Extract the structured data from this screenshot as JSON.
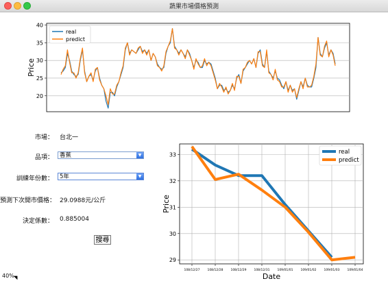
{
  "window": {
    "title": "蔬果市場價格預測"
  },
  "form": {
    "market_label": "市場：",
    "market_value": "台北一",
    "product_label": "品項：",
    "product_value": "香蕉",
    "years_label": "訓練年份數：",
    "years_value": "5年",
    "predicted_label": "預測下次開市價格：",
    "predicted_value": "29.0988元/公斤",
    "r2_label": "決定係數：",
    "r2_value": "0.885004",
    "search_label": "搜尋"
  },
  "status": {
    "progress_text": "40%"
  },
  "colors": {
    "real": "#1f77b4",
    "predict": "#ff7f0e"
  },
  "chart_data": [
    {
      "type": "line",
      "ylabel": "Price",
      "xlabel": "",
      "ylim": [
        15.5,
        40.5
      ],
      "yticks": [
        20,
        25,
        30,
        35,
        40
      ],
      "grid": "horizontal",
      "legend": "top-left",
      "series": [
        {
          "name": "real",
          "values": [
            26.5,
            27,
            28,
            32,
            30,
            27,
            26,
            25.5,
            26,
            30,
            33,
            27,
            24,
            25.5,
            26,
            24.5,
            27,
            28,
            25,
            23,
            22,
            18.5,
            16.5,
            21,
            21,
            20,
            22.5,
            24,
            26,
            28,
            33,
            35,
            32,
            33,
            32.5,
            32,
            33,
            34,
            32.5,
            33,
            32,
            33,
            30,
            32,
            31,
            29,
            28,
            27.5,
            28,
            32,
            34,
            35,
            39,
            34,
            33,
            32,
            33,
            32,
            31,
            33,
            32,
            30,
            28,
            30,
            29.5,
            28,
            28,
            30,
            29,
            29.5,
            29,
            27,
            25,
            22,
            23,
            23,
            21.5,
            22,
            21,
            21.5,
            23,
            22,
            25,
            26,
            23.5,
            27,
            28,
            29,
            30,
            29,
            30.5,
            28,
            32,
            33,
            29,
            28,
            32.5,
            27,
            26,
            25,
            27,
            25,
            24.5,
            23,
            22,
            24,
            21.5,
            23,
            21.5,
            22,
            19,
            21.5,
            24,
            22.5,
            25,
            23,
            22.5,
            22.5,
            25,
            28,
            36.5,
            32,
            31,
            33.5,
            35,
            31.5,
            33,
            32,
            29
          ]
        },
        {
          "name": "predict",
          "values": [
            26,
            27.5,
            28.5,
            33,
            29.5,
            26.5,
            26.5,
            25,
            26.5,
            30.5,
            33.5,
            26.5,
            24,
            25.5,
            26.5,
            24,
            27.5,
            28,
            24.5,
            23,
            22,
            20,
            17.5,
            22,
            20.5,
            20.5,
            23,
            24,
            26.5,
            28.5,
            33.5,
            35,
            31.5,
            33,
            32.5,
            32,
            33.5,
            34,
            32,
            33,
            31.5,
            33,
            30,
            32,
            31,
            28.5,
            28,
            27,
            28.5,
            32.5,
            34,
            35.5,
            39,
            33.5,
            33,
            31.5,
            33,
            32,
            30.5,
            33,
            31.5,
            30,
            27.5,
            30.5,
            29,
            28,
            28.5,
            30.5,
            28.5,
            29.5,
            28.5,
            26.5,
            24.5,
            22,
            23.5,
            22.5,
            21,
            22.5,
            20.5,
            21.5,
            23.5,
            21.5,
            25.5,
            25.5,
            23.5,
            27.5,
            28,
            29.5,
            30,
            29,
            30.5,
            28,
            32.5,
            32.5,
            28.5,
            28,
            33,
            26.5,
            26,
            24.5,
            27.5,
            24.5,
            24,
            22.5,
            22.5,
            24,
            21,
            23,
            21,
            22,
            19.5,
            22,
            24,
            22,
            25,
            22.5,
            22.5,
            23,
            25.5,
            29,
            36.5,
            31.5,
            31,
            34,
            35.5,
            31,
            33,
            31.5,
            28.5
          ]
        }
      ]
    },
    {
      "type": "line",
      "xlabel": "Date",
      "ylabel": "Price",
      "ylim": [
        28.85,
        33.4
      ],
      "yticks": [
        29,
        30,
        31,
        32,
        33
      ],
      "categories": [
        "108/12/27",
        "108/12/28",
        "108/12/29",
        "108/12/31",
        "109/01/01",
        "109/01/02",
        "109/01/03",
        "109/01/04"
      ],
      "grid": "both",
      "legend": "top-right",
      "series": [
        {
          "name": "real",
          "values": [
            33.2,
            32.6,
            32.2,
            32.2,
            31.1,
            30.1,
            29.1,
            null
          ]
        },
        {
          "name": "predict",
          "values": [
            33.3,
            32.05,
            32.25,
            31.65,
            31.0,
            30.05,
            29.0,
            29.1
          ]
        }
      ]
    }
  ]
}
